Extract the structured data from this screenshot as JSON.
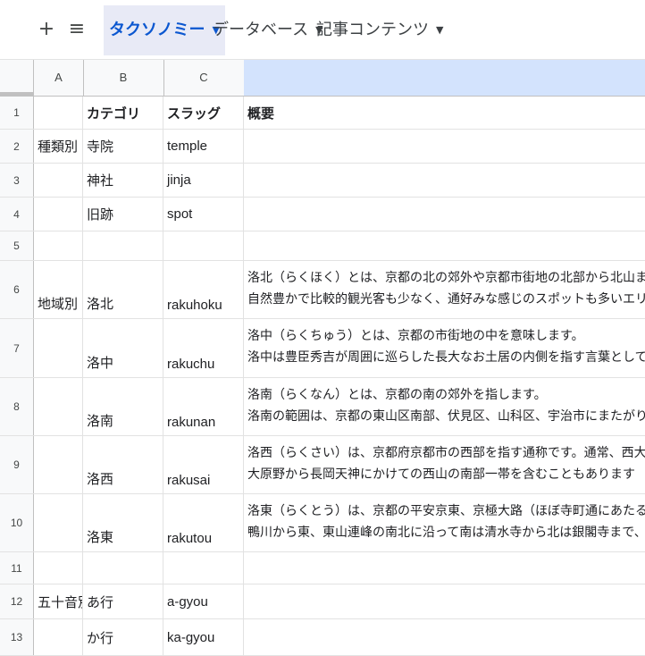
{
  "tabs": [
    {
      "label": "タクソノミー",
      "active": true
    },
    {
      "label": "データベース",
      "active": false
    },
    {
      "label": "記事コンテンツ",
      "active": false
    }
  ],
  "toolbar": {
    "add_label": "+",
    "menu_label": "≡",
    "caret": "▼"
  },
  "columns": [
    "A",
    "B",
    "C",
    ""
  ],
  "rows": [
    {
      "num": "1",
      "A": "",
      "B": "カテゴリ",
      "C": "スラッグ",
      "D": [
        "概要"
      ]
    },
    {
      "num": "2",
      "A": "種類別",
      "B": "寺院",
      "C": "temple",
      "D": []
    },
    {
      "num": "3",
      "A": "",
      "B": "神社",
      "C": "jinja",
      "D": []
    },
    {
      "num": "4",
      "A": "",
      "B": "旧跡",
      "C": "spot",
      "D": []
    },
    {
      "num": "5",
      "A": "",
      "B": "",
      "C": "",
      "D": []
    },
    {
      "num": "6",
      "A": "地域別",
      "B": "洛北",
      "C": "rakuhoku",
      "D": [
        "洛北（らくほく）とは、京都の北の郊外や京都市街地の北部から北山までの一帯を指",
        "自然豊かで比較的観光客も少なく、通好みな感じのスポットも多いエリアです。"
      ]
    },
    {
      "num": "7",
      "A": "",
      "B": "洛中",
      "C": "rakuchu",
      "D": [
        "洛中（らくちゅう）とは、京都の市街地の中を意味します。",
        "洛中は豊臣秀吉が周囲に巡らした長大なお土居の内側を指す言葉としても用いられて"
      ]
    },
    {
      "num": "8",
      "A": "",
      "B": "洛南",
      "C": "rakunan",
      "D": [
        "洛南（らくなん）とは、京都の南の郊外を指します。",
        "洛南の範囲は、京都の東山区南部、伏見区、山科区、宇治市にまたがります。"
      ]
    },
    {
      "num": "9",
      "A": "",
      "B": "洛西",
      "C": "rakusai",
      "D": [
        "洛西（らくさい）は、京都府京都市の西部を指す通称です。通常、西大路以西の鹿苑",
        "大原野から長岡天神にかけての西山の南部一帯を含むこともあります"
      ]
    },
    {
      "num": "10",
      "A": "",
      "B": "洛東",
      "C": "rakutou",
      "D": [
        "洛東（らくとう）は、京都の平安京東、京極大路（ほぼ寺町通にあたる）以東、また",
        "鴨川から東、東山連峰の南北に沿って南は清水寺から北は銀閣寺まで、有名社寺が目"
      ]
    },
    {
      "num": "11",
      "A": "",
      "B": "",
      "C": "",
      "D": []
    },
    {
      "num": "12",
      "A": "五十音別",
      "B": "あ行",
      "C": "a-gyou",
      "D": []
    },
    {
      "num": "13",
      "A": "",
      "B": "か行",
      "C": "ka-gyou",
      "D": []
    }
  ]
}
